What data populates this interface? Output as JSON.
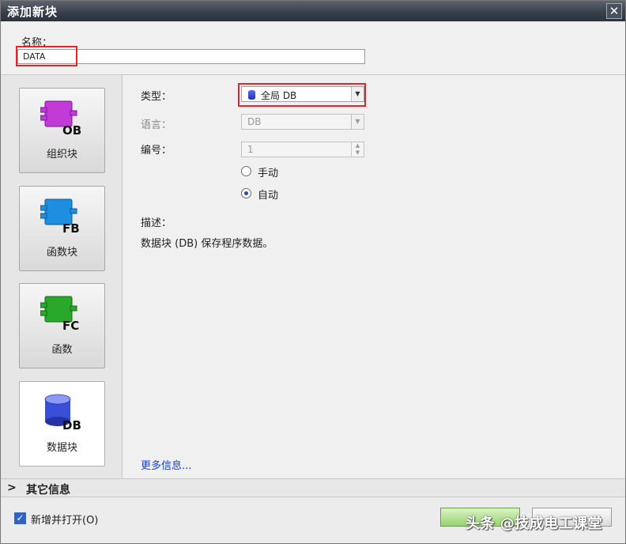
{
  "window": {
    "title": "添加新块",
    "close_glyph": "✕"
  },
  "name": {
    "label": "名称：",
    "value": "DATA"
  },
  "blocks": [
    {
      "tag": "OB",
      "label": "组织块",
      "color": "#c23bd6",
      "icon": "ob-block-icon"
    },
    {
      "tag": "FB",
      "label": "函数块",
      "color": "#1e8fe0",
      "icon": "fb-block-icon"
    },
    {
      "tag": "FC",
      "label": "函数",
      "color": "#2aa82a",
      "icon": "fc-block-icon"
    },
    {
      "tag": "DB",
      "label": "数据块",
      "color": "#3a4fd8",
      "icon": "db-block-icon"
    }
  ],
  "form": {
    "type_label": "类型：",
    "type_value": "全局 DB",
    "language_label": "语言：",
    "language_value": "DB",
    "number_label": "编号：",
    "number_value": "1",
    "manual_label": "手动",
    "auto_label": "自动",
    "selected_mode": "auto",
    "description_label": "描述：",
    "description_text": "数据块 (DB) 保存程序数据。"
  },
  "more_info_link": "更多信息...",
  "other_info": {
    "chevron": ">",
    "label": "其它信息"
  },
  "footer": {
    "add_open_label": "新增并打开(O)",
    "add_open_checked": true,
    "ok_label": "",
    "cancel_label": "取消"
  },
  "watermark": "头条 @技成电工课堂",
  "colors": {
    "highlight": "#e0262b",
    "link": "#1b3ed1",
    "ok_button": "#98d46f"
  }
}
